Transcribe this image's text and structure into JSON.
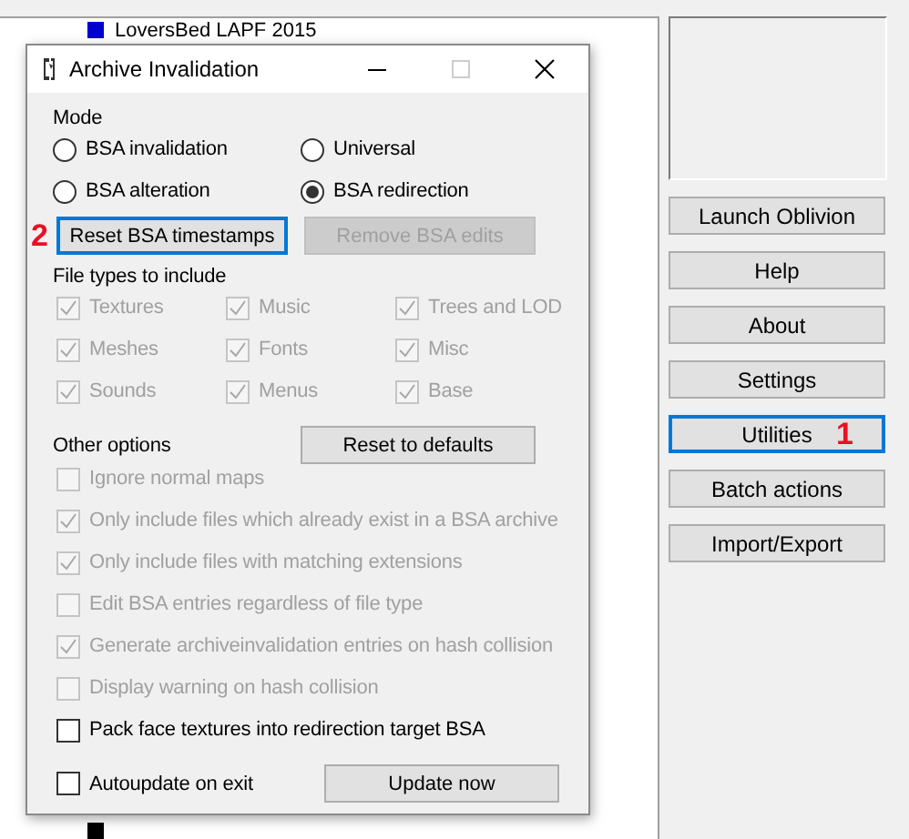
{
  "background_list": {
    "items": [
      {
        "label": "LoversBed LAPF 2015",
        "color": "#0000cc"
      },
      {
        "color": "#000000"
      }
    ]
  },
  "side_buttons": [
    {
      "label": "Launch Oblivion",
      "focused": false
    },
    {
      "label": "Help",
      "focused": false
    },
    {
      "label": "About",
      "focused": false
    },
    {
      "label": "Settings",
      "focused": false
    },
    {
      "label": "Utilities",
      "focused": true,
      "annotation": "1"
    },
    {
      "label": "Batch actions",
      "focused": false
    },
    {
      "label": "Import/Export",
      "focused": false
    }
  ],
  "dialog": {
    "title": "Archive Invalidation",
    "mode": {
      "label": "Mode",
      "options": [
        {
          "label": "BSA invalidation",
          "selected": false
        },
        {
          "label": "Universal",
          "selected": false
        },
        {
          "label": "BSA alteration",
          "selected": false
        },
        {
          "label": "BSA redirection",
          "selected": true
        }
      ]
    },
    "mode_buttons": [
      {
        "label": "Reset BSA timestamps",
        "disabled": false,
        "focused": true,
        "annotation": "2"
      },
      {
        "label": "Remove BSA edits",
        "disabled": true,
        "focused": false
      }
    ],
    "file_types": {
      "label": "File types to include",
      "items": [
        {
          "label": "Textures",
          "checked": true,
          "disabled": true
        },
        {
          "label": "Music",
          "checked": true,
          "disabled": true
        },
        {
          "label": "Trees and LOD",
          "checked": true,
          "disabled": true
        },
        {
          "label": "Meshes",
          "checked": true,
          "disabled": true
        },
        {
          "label": "Fonts",
          "checked": true,
          "disabled": true
        },
        {
          "label": "Misc",
          "checked": true,
          "disabled": true
        },
        {
          "label": "Sounds",
          "checked": true,
          "disabled": true
        },
        {
          "label": "Menus",
          "checked": true,
          "disabled": true
        },
        {
          "label": "Base",
          "checked": true,
          "disabled": true
        }
      ]
    },
    "other_options": {
      "label": "Other options",
      "reset_button": {
        "label": "Reset to defaults"
      },
      "items": [
        {
          "label": "Ignore normal maps",
          "checked": false,
          "disabled": true
        },
        {
          "label": "Only include files which already exist in a BSA archive",
          "checked": true,
          "disabled": true
        },
        {
          "label": "Only include files with matching extensions",
          "checked": true,
          "disabled": true
        },
        {
          "label": "Edit BSA entries regardless of file type",
          "checked": false,
          "disabled": true
        },
        {
          "label": "Generate archiveinvalidation entries on hash collision",
          "checked": true,
          "disabled": true
        },
        {
          "label": "Display warning on hash collision",
          "checked": false,
          "disabled": true
        },
        {
          "label": "Pack face textures into redirection target BSA",
          "checked": false,
          "disabled": false
        }
      ]
    },
    "autoupdate": {
      "label": "Autoupdate on exit",
      "checked": false,
      "disabled": false
    },
    "update_button": {
      "label": "Update now"
    }
  }
}
